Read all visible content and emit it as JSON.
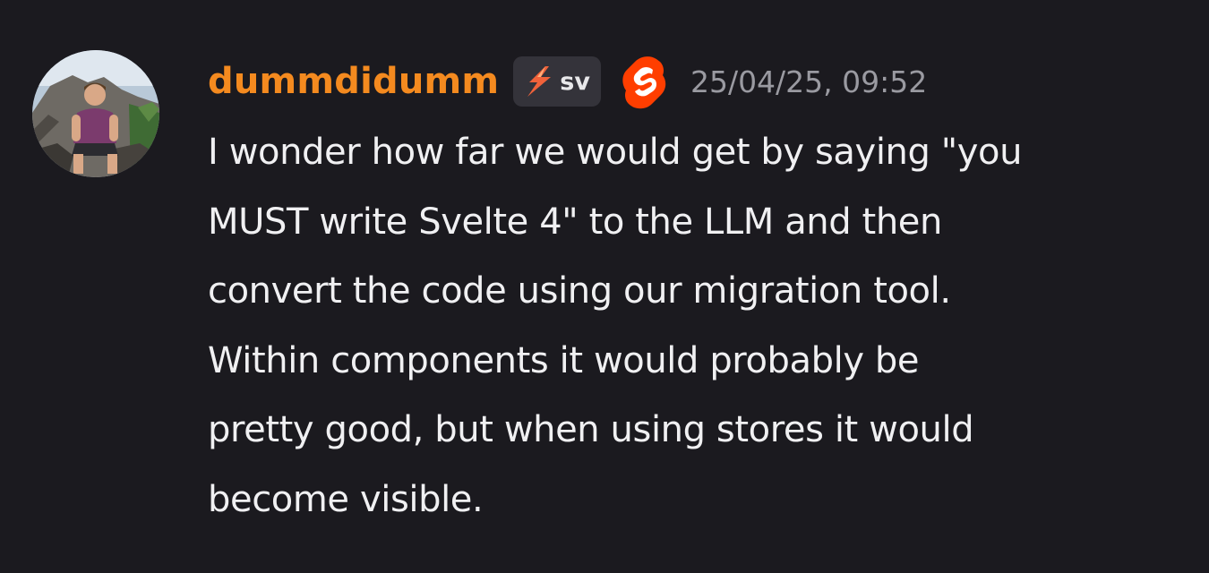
{
  "message": {
    "author": {
      "username": "dummdidumm",
      "username_color": "#f48a1f",
      "avatar_icon": "user-avatar",
      "server_tag": {
        "icon": "lightning-bolt-icon",
        "text": "sv"
      },
      "role_icon": "svelte-logo-icon",
      "role_icon_color": "#ff3e00"
    },
    "timestamp": "25/04/25, 09:52",
    "lines": [
      "I wonder how far we would get by saying \"you",
      "MUST write Svelte 4\" to the LLM and then",
      "convert the code using our migration tool.",
      "Within components it would probably be",
      "pretty good, but when using stores it would",
      "become visible."
    ]
  },
  "theme": {
    "background": "#1b1a1f",
    "text": "#f0f0f2",
    "muted": "#9a9aa1",
    "tag_background": "#34333a"
  }
}
